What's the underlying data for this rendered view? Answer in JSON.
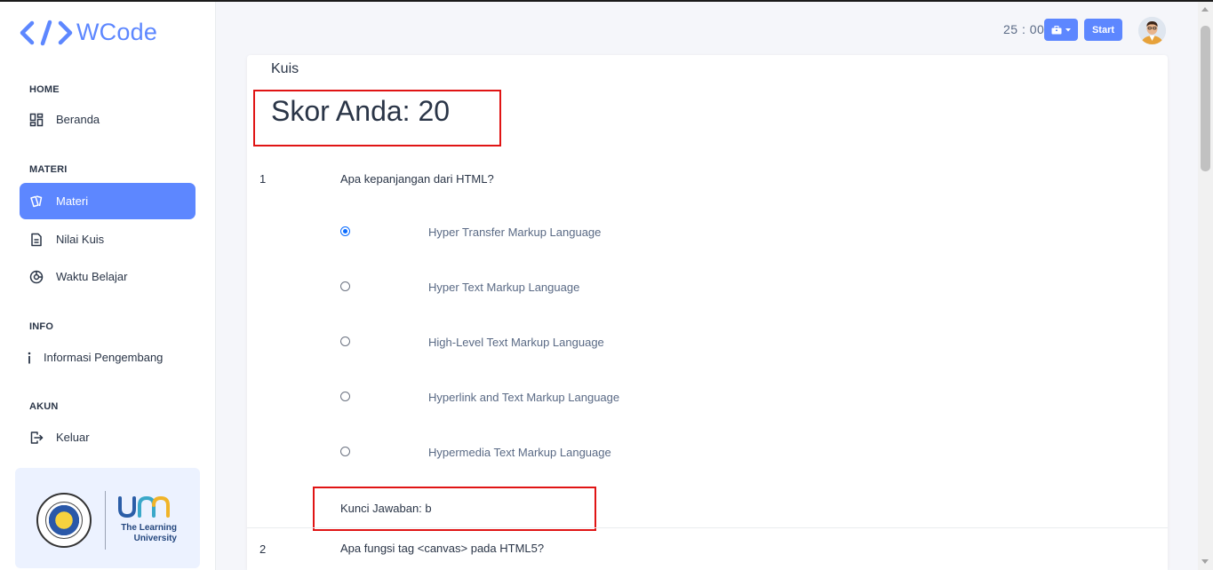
{
  "app": {
    "name": "WCode",
    "brand_color": "#5d87ff"
  },
  "sidebar": {
    "sections": [
      {
        "caption": "HOME",
        "items": [
          {
            "label": "Beranda",
            "icon": "layout-dashboard-icon"
          }
        ]
      },
      {
        "caption": "MATERI",
        "items": [
          {
            "label": "Materi",
            "icon": "cards-icon",
            "active": true
          },
          {
            "label": "Nilai Kuis",
            "icon": "file-text-icon"
          },
          {
            "label": "Waktu Belajar",
            "icon": "chart-donut-icon"
          }
        ]
      },
      {
        "caption": "INFO",
        "items": [
          {
            "label": "Informasi Pengembang",
            "icon": "info-icon"
          }
        ]
      },
      {
        "caption": "AKUN",
        "items": [
          {
            "label": "Keluar",
            "icon": "logout-icon"
          }
        ]
      }
    ],
    "partner": {
      "caption_line1": "The Learning",
      "caption_line2": "University"
    }
  },
  "header": {
    "timer": "25 : 00",
    "start_label": "Start"
  },
  "quiz": {
    "title": "Kuis",
    "score_text": "Skor Anda: 20",
    "questions": [
      {
        "number": "1",
        "text": "Apa kepanjangan dari HTML?",
        "options": [
          {
            "text": "Hyper Transfer Markup Language",
            "checked": true
          },
          {
            "text": "Hyper Text Markup Language",
            "checked": false
          },
          {
            "text": "High-Level Text Markup Language",
            "checked": false
          },
          {
            "text": "Hyperlink and Text Markup Language",
            "checked": false
          },
          {
            "text": "Hypermedia Text Markup Language",
            "checked": false
          }
        ],
        "answer_key": "Kunci Jawaban: b"
      },
      {
        "number": "2",
        "text": "Apa fungsi tag <canvas> pada HTML5?"
      }
    ]
  },
  "highlight_color": "#e01414"
}
